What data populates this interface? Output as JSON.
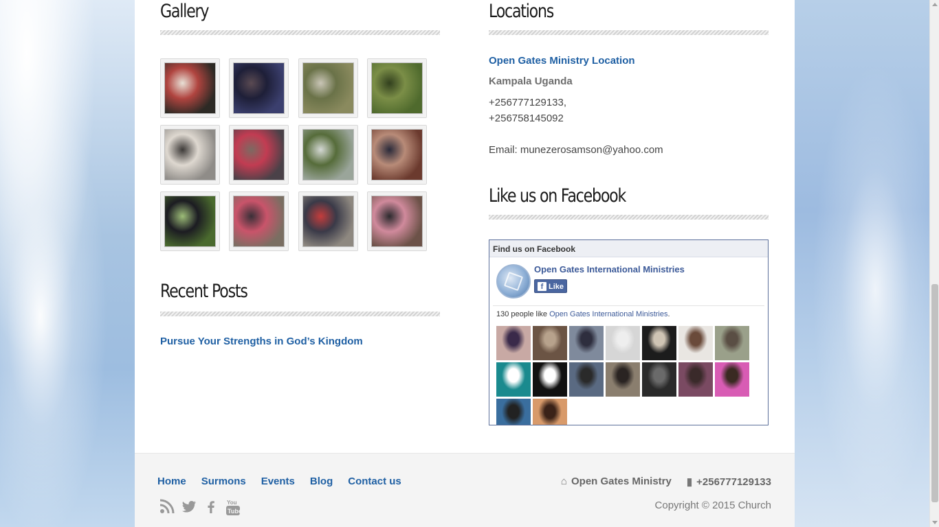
{
  "gallery": {
    "title": "Gallery",
    "thumbnails": [
      {
        "colors": [
          "#2d2a25",
          "#b0443f",
          "#e8e0d6"
        ]
      },
      {
        "colors": [
          "#3b3f6e",
          "#1e1f38",
          "#5a4a52"
        ]
      },
      {
        "colors": [
          "#8a8a5e",
          "#6a7248",
          "#c9c5b6"
        ]
      },
      {
        "colors": [
          "#4f6a2d",
          "#7b8e47",
          "#32401e"
        ]
      },
      {
        "colors": [
          "#8f8c88",
          "#ded8d0",
          "#3d3a38"
        ]
      },
      {
        "colors": [
          "#4a4148",
          "#c23c52",
          "#7c6a62"
        ]
      },
      {
        "colors": [
          "#9aa59a",
          "#566c3a",
          "#d4d8d4"
        ]
      },
      {
        "colors": [
          "#6b3a2e",
          "#b88b78",
          "#2a2a3a"
        ]
      },
      {
        "colors": [
          "#4a6a2e",
          "#1c1c22",
          "#9dbd78"
        ]
      },
      {
        "colors": [
          "#7a6e62",
          "#c9546a",
          "#3a3038"
        ]
      },
      {
        "colors": [
          "#8e8880",
          "#3a3a48",
          "#c43c3c"
        ]
      },
      {
        "colors": [
          "#6c5248",
          "#d08a9c",
          "#2c2a2e"
        ]
      }
    ]
  },
  "recent_posts": {
    "title": "Recent Posts",
    "items": [
      "Pursue Your Strengths in God’s Kingdom"
    ]
  },
  "locations": {
    "title": "Locations",
    "name": "Open Gates Ministry Location",
    "city": "Kampala Uganda",
    "phone1": "+256777129133,",
    "phone2": "+256758145092",
    "email": "Email: munezerosamson@yahoo.com"
  },
  "facebook": {
    "section_title": "Like us on Facebook",
    "box_header": "Find us on Facebook",
    "page_name": "Open Gates International Ministries",
    "like_label": "Like",
    "count_prefix": "130 people like ",
    "count_name": "Open Gates International Ministries",
    "count_suffix": ".",
    "faces": [
      {
        "bg": "#c8a9a4",
        "fg": "#3a2a4a"
      },
      {
        "bg": "#6b5444",
        "fg": "#b7a28c"
      },
      {
        "bg": "#7f8a9c",
        "fg": "#2e2e3e"
      },
      {
        "bg": "#d6d6d6",
        "fg": "#eeeeee"
      },
      {
        "bg": "#1c1c1c",
        "fg": "#cfc4b4"
      },
      {
        "bg": "#e9e6e2",
        "fg": "#6a4a3a"
      },
      {
        "bg": "#9aa08a",
        "fg": "#5a4e44"
      },
      {
        "bg": "#1a8a8e",
        "fg": "#ffffff"
      },
      {
        "bg": "#111111",
        "fg": "#ffffff"
      },
      {
        "bg": "#5a6a82",
        "fg": "#2a2a2a"
      },
      {
        "bg": "#8a7e6e",
        "fg": "#2a2422"
      },
      {
        "bg": "#2a2a2a",
        "fg": "#6a6a6a"
      },
      {
        "bg": "#7a4a62",
        "fg": "#3a2a2a"
      },
      {
        "bg": "#d85cb4",
        "fg": "#3a2a22"
      },
      {
        "bg": "#3a6e9e",
        "fg": "#222222"
      },
      {
        "bg": "#d89a6a",
        "fg": "#3a2218"
      }
    ]
  },
  "footer": {
    "nav": [
      "Home",
      "Surmons",
      "Events",
      "Blog",
      "Contact us"
    ],
    "social_icons": [
      "rss-icon",
      "twitter-icon",
      "facebook-icon",
      "youtube-icon"
    ],
    "address": "Open Gates Ministry",
    "phone": "+256777129133",
    "copyright": "Copyright © 2015 Church"
  },
  "colors": {
    "link": "#1e5fa3",
    "fb_blue": "#3b5998"
  }
}
